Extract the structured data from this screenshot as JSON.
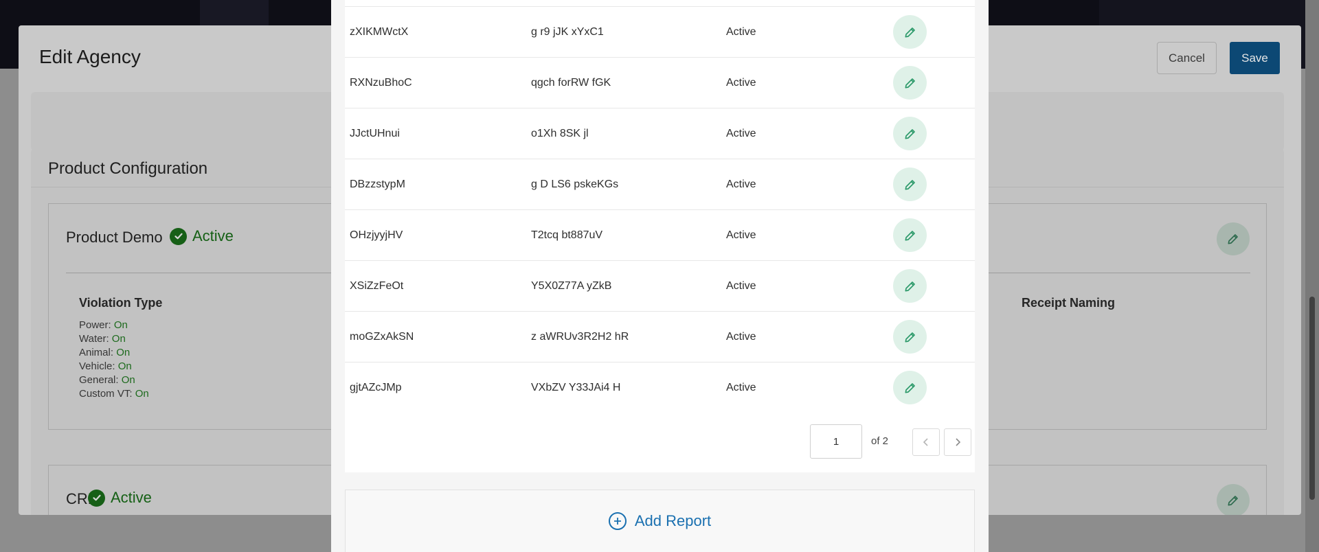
{
  "background_modal": {
    "title": "Edit Agency",
    "cancel_label": "Cancel",
    "save_label": "Save",
    "section_title": "Product Configuration",
    "products": [
      {
        "name": "Product Demo",
        "status": "Active"
      },
      {
        "name": "CRM",
        "status": "Active"
      }
    ],
    "violation_type": {
      "title": "Violation Type",
      "items": [
        {
          "label": "Power:",
          "value": "On"
        },
        {
          "label": "Water:",
          "value": "On"
        },
        {
          "label": "Animal:",
          "value": "On"
        },
        {
          "label": "Vehicle:",
          "value": "On"
        },
        {
          "label": "General:",
          "value": "On"
        },
        {
          "label": "Custom VT:",
          "value": "On"
        }
      ]
    },
    "receipt_naming_title": "Receipt Naming"
  },
  "reports": {
    "rows": [
      {
        "name": "zXIKMWctX",
        "code": "g r9 jJK xYxC1",
        "status": "Active"
      },
      {
        "name": "RXNzuBhoC",
        "code": "qgch forRW fGK",
        "status": "Active"
      },
      {
        "name": "JJctUHnui",
        "code": "o1Xh 8SK jl",
        "status": "Active"
      },
      {
        "name": "DBzzstypM",
        "code": "g D LS6 pskeKGs",
        "status": "Active"
      },
      {
        "name": "OHzjyyjHV",
        "code": "T2tcq bt887uV",
        "status": "Active"
      },
      {
        "name": "XSiZzFeOt",
        "code": "Y5X0Z77A yZkB",
        "status": "Active"
      },
      {
        "name": "moGZxAkSN",
        "code": "z aWRUv3R2H2 hR",
        "status": "Active"
      },
      {
        "name": "gjtAZcJMp",
        "code": "VXbZV Y33JAi4 H",
        "status": "Active"
      }
    ],
    "pagination": {
      "current_page": "1",
      "total_label": "of 2"
    },
    "add_report_label": "Add Report"
  },
  "colors": {
    "accent_blue": "#1a70b0",
    "active_green": "#1d7a1d",
    "edit_green": "#2d9a6a"
  },
  "icons": {
    "edit": "pencil-icon",
    "status": "check-circle-icon",
    "add": "plus-circle-icon",
    "prev": "chevron-left-icon",
    "next": "chevron-right-icon"
  }
}
